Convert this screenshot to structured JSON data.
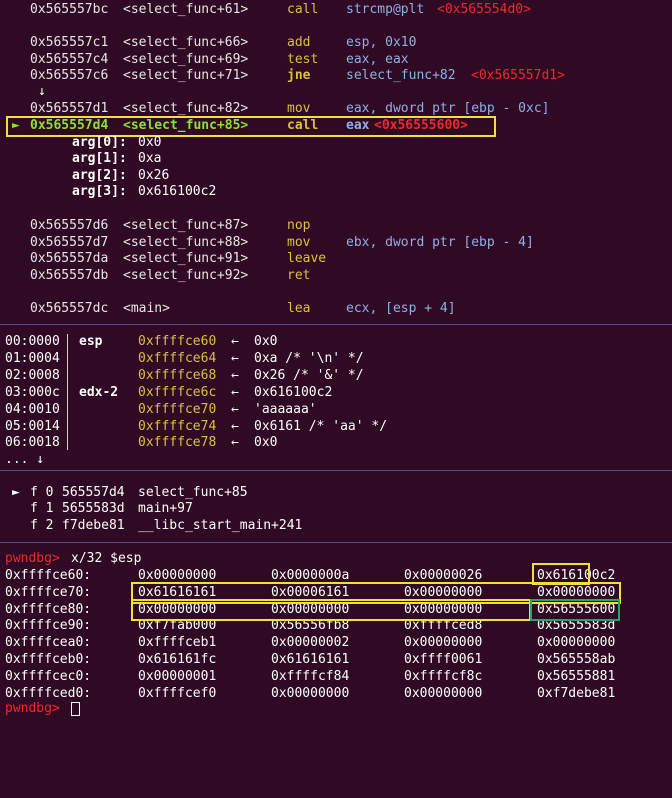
{
  "disasm": [
    {
      "addr": "0x565557bc",
      "sym": "<select_func+61>",
      "op": "call",
      "operand": "strcmp@plt",
      "target": "<0x565554d0>"
    },
    {
      "addr": "0x565557c1",
      "sym": "<select_func+66>",
      "op": "add",
      "operand": "esp, 0x10",
      "target": ""
    },
    {
      "addr": "0x565557c4",
      "sym": "<select_func+69>",
      "op": "test",
      "operand": "eax, eax",
      "target": ""
    },
    {
      "addr": "0x565557c6",
      "sym": "<select_func+71>",
      "op": "jne",
      "operand": "select_func+82",
      "target": "<0x565557d1>"
    },
    {
      "addr": "0x565557d1",
      "sym": "<select_func+82>",
      "op": "mov",
      "operand": "eax, dword ptr [ebp - 0xc]",
      "target": ""
    },
    {
      "addr": "0x565557d4",
      "sym": "<select_func+85>",
      "op": "call",
      "operand": "eax",
      "target": "<0x56555600>"
    },
    {
      "addr": "0x565557d6",
      "sym": "<select_func+87>",
      "op": "nop",
      "operand": "",
      "target": ""
    },
    {
      "addr": "0x565557d7",
      "sym": "<select_func+88>",
      "op": "mov",
      "operand": "ebx, dword ptr [ebp - 4]",
      "target": ""
    },
    {
      "addr": "0x565557da",
      "sym": "<select_func+91>",
      "op": "leave",
      "operand": "",
      "target": ""
    },
    {
      "addr": "0x565557db",
      "sym": "<select_func+92>",
      "op": "ret",
      "operand": "",
      "target": ""
    },
    {
      "addr": "0x565557dc",
      "sym": "<main>",
      "op": "lea",
      "operand": "ecx, [esp + 4]",
      "target": ""
    }
  ],
  "jump_arrow": "↓",
  "current_marker": "►",
  "args": [
    {
      "name": "arg[0]:",
      "value": "0x0"
    },
    {
      "name": "arg[1]:",
      "value": "0xa"
    },
    {
      "name": "arg[2]:",
      "value": "0x26"
    },
    {
      "name": "arg[3]:",
      "value": "0x616100c2"
    }
  ],
  "stack": [
    {
      "idx": "00:0000",
      "reg": "esp",
      "addr": "0xffffce60",
      "arrow": "←",
      "val": "0x0"
    },
    {
      "idx": "01:0004",
      "reg": "",
      "addr": "0xffffce64",
      "arrow": "←",
      "val": "0xa /* '\\n' */"
    },
    {
      "idx": "02:0008",
      "reg": "",
      "addr": "0xffffce68",
      "arrow": "←",
      "val": "0x26 /* '&' */"
    },
    {
      "idx": "03:000c",
      "reg": "edx-2",
      "addr": "0xffffce6c",
      "arrow": "←",
      "val": "0x616100c2"
    },
    {
      "idx": "04:0010",
      "reg": "",
      "addr": "0xffffce70",
      "arrow": "←",
      "val": "'aaaaaa'"
    },
    {
      "idx": "05:0014",
      "reg": "",
      "addr": "0xffffce74",
      "arrow": "←",
      "val": "0x6161 /* 'aa' */"
    },
    {
      "idx": "06:0018",
      "reg": "",
      "addr": "0xffffce78",
      "arrow": "←",
      "val": "0x0"
    }
  ],
  "stack_more": "... ↓",
  "backtrace": [
    {
      "marker": "►",
      "frame": "f 0",
      "addr": "565557d4",
      "sym": "select_func+85"
    },
    {
      "marker": "",
      "frame": "f 1",
      "addr": "5655583d",
      "sym": "main+97"
    },
    {
      "marker": "",
      "frame": "f 2",
      "addr": "f7debe81",
      "sym": "__libc_start_main+241"
    }
  ],
  "prompt": "pwndbg>",
  "command": "x/32 $esp",
  "memory": [
    {
      "addr": "0xffffce60:",
      "w": [
        "0x00000000",
        "0x0000000a",
        "0x00000026",
        "0x616100c2"
      ]
    },
    {
      "addr": "0xffffce70:",
      "w": [
        "0x61616161",
        "0x00006161",
        "0x00000000",
        "0x00000000"
      ]
    },
    {
      "addr": "0xffffce80:",
      "w": [
        "0x00000000",
        "0x00000000",
        "0x00000000",
        "0x56555600"
      ]
    },
    {
      "addr": "0xffffce90:",
      "w": [
        "0xf7fab000",
        "0x56556fb8",
        "0xffffced8",
        "0x5655583d"
      ]
    },
    {
      "addr": "0xffffcea0:",
      "w": [
        "0xffffceb1",
        "0x00000002",
        "0x00000000",
        "0x00000000"
      ]
    },
    {
      "addr": "0xffffceb0:",
      "w": [
        "0x616161fc",
        "0x61616161",
        "0xffff0061",
        "0x565558ab"
      ]
    },
    {
      "addr": "0xffffcec0:",
      "w": [
        "0x00000001",
        "0xffffcf84",
        "0xffffcf8c",
        "0x56555881"
      ]
    },
    {
      "addr": "0xffffced0:",
      "w": [
        "0xffffcef0",
        "0x00000000",
        "0x00000000",
        "0xf7debe81"
      ]
    }
  ],
  "final_prompt": "pwndbg>"
}
